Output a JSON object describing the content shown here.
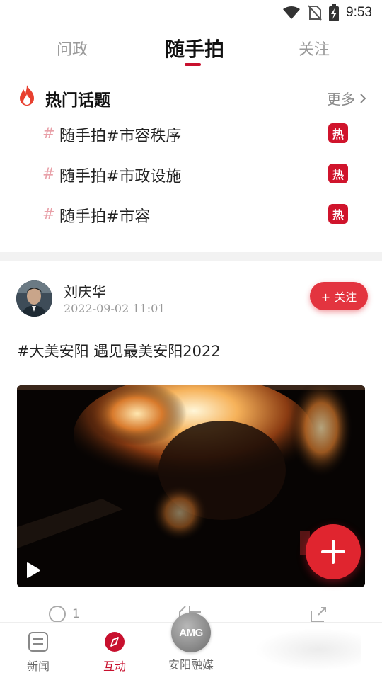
{
  "status_bar": {
    "time": "9:53"
  },
  "top_tabs": [
    {
      "label": "问政",
      "active": false
    },
    {
      "label": "随手拍",
      "active": true
    },
    {
      "label": "关注",
      "active": false
    }
  ],
  "hot_topics": {
    "title": "热门话题",
    "more_label": "更多",
    "items": [
      {
        "hash": "#",
        "text": "随手拍#市容秩序",
        "badge": "热"
      },
      {
        "hash": "#",
        "text": "随手拍#市政设施",
        "badge": "热"
      },
      {
        "hash": "#",
        "text": "随手拍#市容",
        "badge": "热"
      }
    ]
  },
  "post": {
    "author": "刘庆华",
    "time": "2022-09-02 11:01",
    "follow_label": "+ 关注",
    "text": "#大美安阳 遇见最美安阳2022",
    "comment_count": "1"
  },
  "bottom_nav": [
    {
      "label": "新闻",
      "active": false
    },
    {
      "label": "互动",
      "active": true
    },
    {
      "label": "安阳融媒",
      "logo_text": "AMG",
      "active": false
    }
  ],
  "colors": {
    "accent": "#c8102e",
    "follow": "#e3343f",
    "fab": "#e0252f"
  }
}
